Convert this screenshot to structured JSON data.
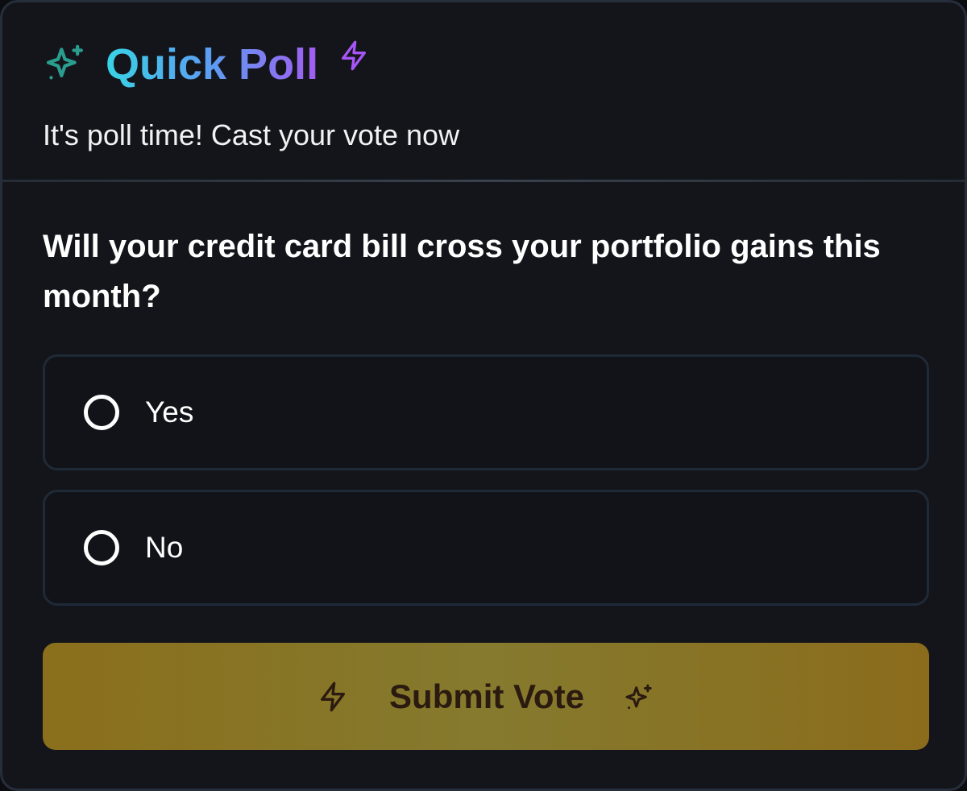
{
  "header": {
    "title": "Quick Poll",
    "subtitle": "It's poll time! Cast your vote now",
    "title_icon": "sparkles-icon",
    "title_accent_icon": "lightning-bolt-icon"
  },
  "poll": {
    "question": "Will your credit card bill cross your portfolio gains this month?",
    "options": [
      {
        "label": "Yes",
        "selected": false
      },
      {
        "label": "No",
        "selected": false
      }
    ]
  },
  "submit": {
    "label": "Submit Vote",
    "left_icon": "lightning-bolt-icon",
    "right_icon": "sparkles-icon"
  },
  "colors": {
    "background": "#14151a",
    "title_gradient": [
      "#38d3e6",
      "#5d9cf2",
      "#a25cf0"
    ],
    "sparkle_icon": "#2a9d8f",
    "bolt_icon": "#a855f7",
    "button": "#857a2e",
    "button_text": "#2b1a10"
  }
}
